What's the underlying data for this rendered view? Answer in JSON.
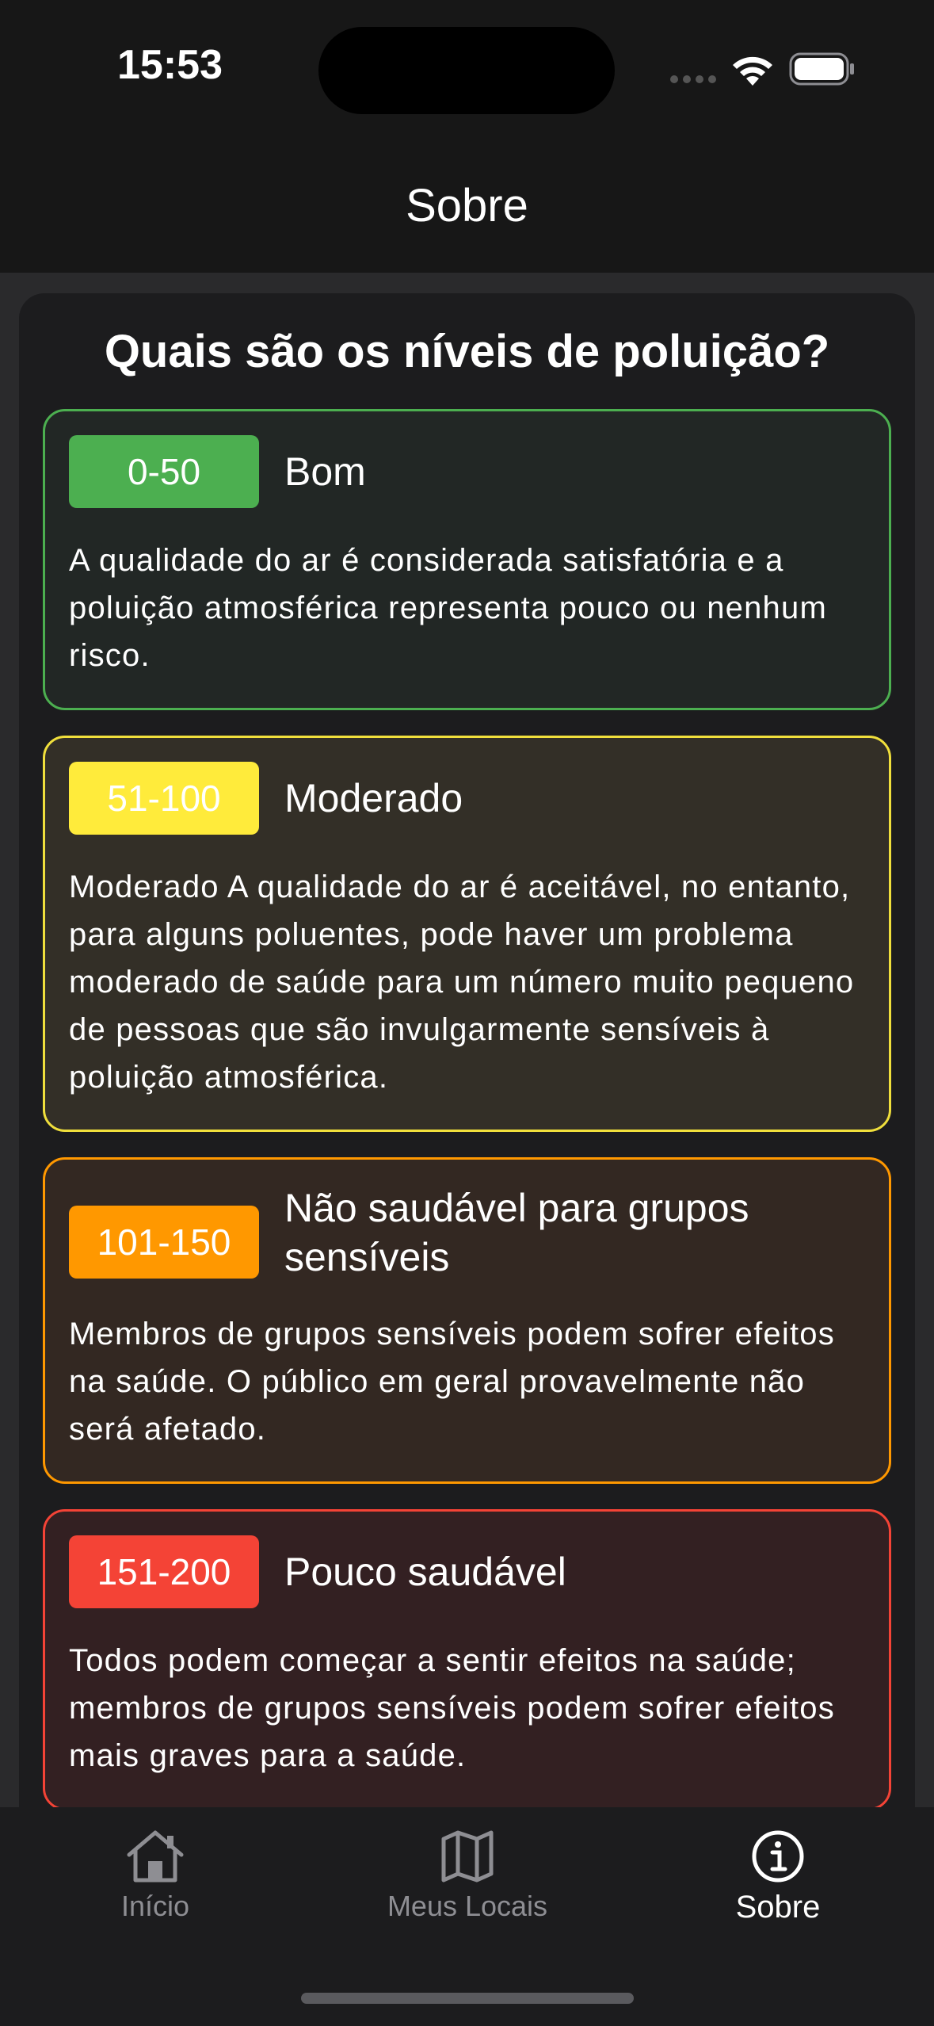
{
  "status_bar": {
    "time": "15:53"
  },
  "nav": {
    "title": "Sobre"
  },
  "main": {
    "heading": "Quais são os níveis de poluição?",
    "levels": [
      {
        "range": "0-50",
        "name": "Bom",
        "color": "#4caf50",
        "description": "A qualidade do ar é considerada satisfatória e a poluição atmosférica representa pouco ou nenhum risco."
      },
      {
        "range": "51-100",
        "name": "Moderado",
        "color": "#ffeb3b",
        "description": "Moderado A qualidade do ar é aceitável, no entanto, para alguns poluentes, pode haver um problema moderado de saúde para um número muito pequeno de pessoas que são invulgarmente sensíveis à poluição atmosférica."
      },
      {
        "range": "101-150",
        "name": "Não saudável para grupos sensíveis",
        "color": "#ff9800",
        "description": "Membros de grupos sensíveis podem sofrer efeitos na saúde. O público em geral provavelmente não será afetado."
      },
      {
        "range": "151-200",
        "name": "Pouco saudável",
        "color": "#f44336",
        "description": "Todos podem começar a sentir efeitos na saúde; membros de grupos sensíveis podem sofrer efeitos mais graves para a saúde."
      }
    ]
  },
  "tab_bar": {
    "tabs": [
      {
        "label": "Início",
        "icon": "home-icon",
        "active": false
      },
      {
        "label": "Meus Locais",
        "icon": "map-icon",
        "active": false
      },
      {
        "label": "Sobre",
        "icon": "info-icon",
        "active": true
      }
    ]
  }
}
